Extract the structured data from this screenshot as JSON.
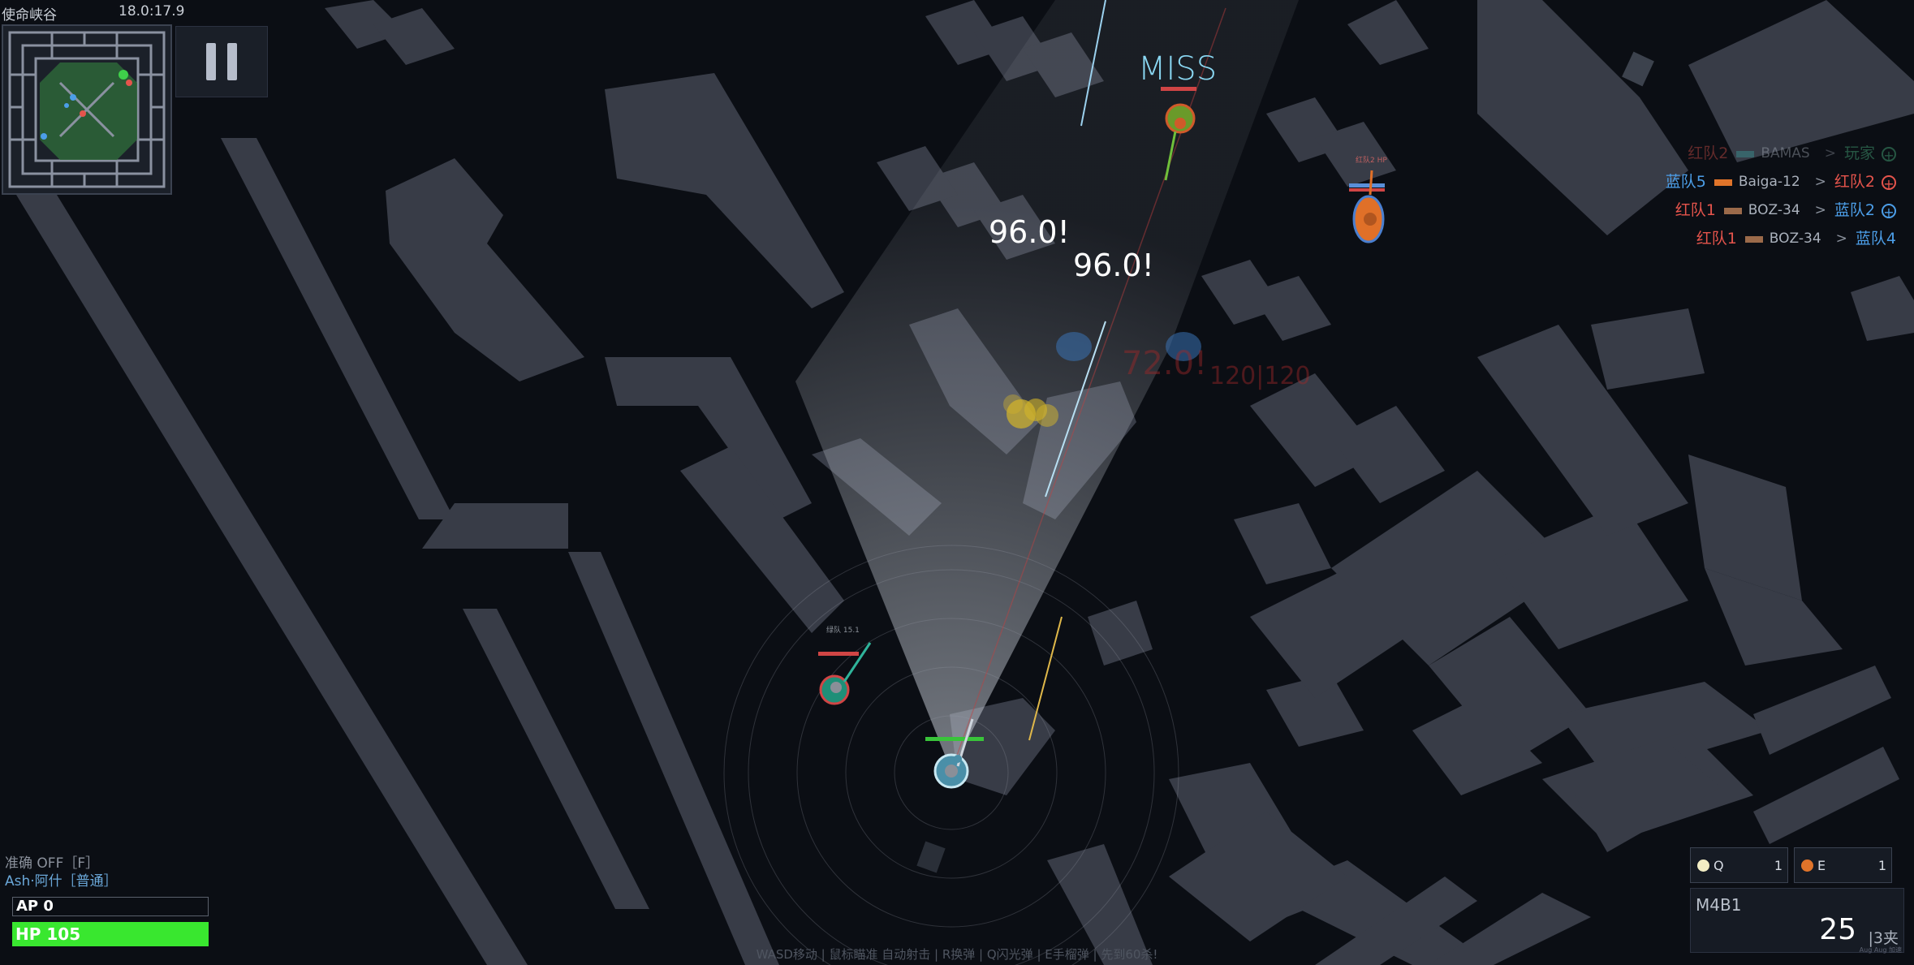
{
  "header": {
    "map_name": "使命峡谷",
    "timer": "18.0:17.9"
  },
  "pause_button": {
    "icon": "pause-icon"
  },
  "floating_text": {
    "miss": "MISS",
    "damage_1": "96.0!",
    "damage_2": "96.0!",
    "damage_faded": "72.0!",
    "damage_faded_b": "120|120",
    "enemy_tag_top": "红队2 HP",
    "enemy_tag_left": "绿队 15.1"
  },
  "killfeed": [
    {
      "killer": "红队2",
      "killer_team": "red",
      "weapon": "BAMAS",
      "weapon_color": "#3aa0a0",
      "victim": "玩家",
      "victim_team": "green",
      "faded": true
    },
    {
      "killer": "蓝队5",
      "killer_team": "blue",
      "weapon": "Baiga-12",
      "weapon_color": "#e0742a",
      "victim": "红队2",
      "victim_team": "red",
      "faded": false
    },
    {
      "killer": "红队1",
      "killer_team": "red",
      "weapon": "BOZ-34",
      "weapon_color": "#9b6a4a",
      "victim": "蓝队2",
      "victim_team": "blue",
      "faded": false
    },
    {
      "killer": "红队1",
      "killer_team": "red",
      "weapon": "BOZ-34",
      "weapon_color": "#9b6a4a",
      "victim": "蓝队4",
      "victim_team": "blue",
      "faded": false
    }
  ],
  "player": {
    "aim_status": "准确 OFF［F］",
    "name": "Ash·阿什［普通］",
    "ap_label": "AP 0",
    "hp_label": "HP 105",
    "hp_fraction": 1.0
  },
  "abilities": {
    "q": {
      "key": "Q",
      "count": "1",
      "color": "#f2edc4"
    },
    "e": {
      "key": "E",
      "count": "1",
      "color": "#e0742a"
    }
  },
  "weapon": {
    "name": "M4B1",
    "ammo": "25",
    "magazines": "|3夹",
    "sub": "Aug Aug 加速"
  },
  "hint": "WASD移动 | 鼠标瞄准 自动射击 | R换弹 | Q闪光弹 | E手榴弹 | 先到60杀!",
  "colors": {
    "background": "#0b0e14",
    "wall": "#383c47",
    "red_team": "#e5544c",
    "blue_team": "#4c9ee8",
    "green_team": "#4fc28a",
    "hp": "#39e72f"
  }
}
